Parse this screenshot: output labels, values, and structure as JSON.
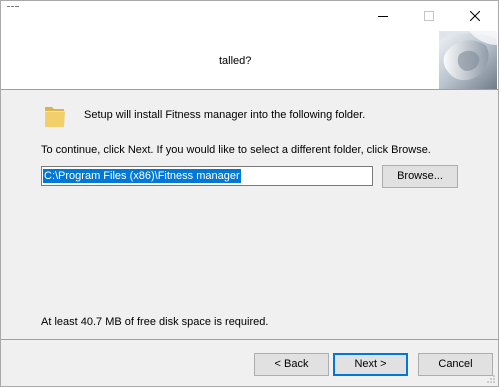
{
  "window": {
    "header_title": "talled?",
    "icons": {
      "app": "setup-app-icon",
      "minimize": "minimize-icon",
      "maximize": "maximize-icon",
      "close": "close-icon",
      "folder": "folder-icon",
      "wizard": "wizard-image"
    }
  },
  "content": {
    "install_text": "Setup will install Fitness manager into the following folder.",
    "instruction": "To continue, click Next. If you would like to select a different folder, click Browse.",
    "path_value": "C:\\Program Files (x86)\\Fitness manager",
    "browse_label": "Browse...",
    "disk_space_text": "At least 40.7 MB of free disk space is required."
  },
  "footer": {
    "back_label": "< Back",
    "next_label": "Next >",
    "cancel_label": "Cancel"
  },
  "colors": {
    "accent": "#0078d7",
    "panel": "#f0f0f0",
    "button": "#e1e1e1"
  }
}
